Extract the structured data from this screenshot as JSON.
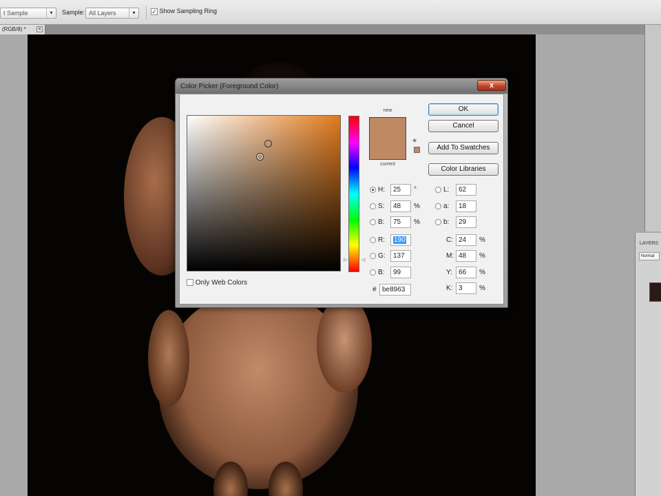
{
  "options_bar": {
    "sample_size": "t Sample",
    "sample_label": "Sample:",
    "sample_value": "All Layers",
    "show_ring_label": "Show Sampling Ring",
    "show_ring_checked": true
  },
  "document_tab": {
    "label": "(RGB/8) *",
    "close": "×"
  },
  "dialog": {
    "title": "Color Picker (Foreground Color)",
    "close": "x",
    "new_label": "new",
    "current_label": "current",
    "buttons": {
      "ok": "OK",
      "cancel": "Cancel",
      "add_to_swatches": "Add To Swatches",
      "color_libraries": "Color Libraries"
    },
    "hsb": [
      {
        "label": "H:",
        "value": "25",
        "unit": "°",
        "selected": true
      },
      {
        "label": "S:",
        "value": "48",
        "unit": "%",
        "selected": false
      },
      {
        "label": "B:",
        "value": "75",
        "unit": "%",
        "selected": false
      }
    ],
    "rgb": [
      {
        "label": "R:",
        "value": "190",
        "selected": false
      },
      {
        "label": "G:",
        "value": "137",
        "selected": false
      },
      {
        "label": "B:",
        "value": "99",
        "selected": false
      }
    ],
    "lab": [
      {
        "label": "L:",
        "value": "62"
      },
      {
        "label": "a:",
        "value": "18"
      },
      {
        "label": "b:",
        "value": "29"
      }
    ],
    "cmyk": [
      {
        "label": "C:",
        "value": "24",
        "unit": "%"
      },
      {
        "label": "M:",
        "value": "48",
        "unit": "%"
      },
      {
        "label": "Y:",
        "value": "66",
        "unit": "%"
      },
      {
        "label": "K:",
        "value": "3",
        "unit": "%"
      }
    ],
    "hex_label": "#",
    "hex": "be8963",
    "only_web_colors": "Only Web Colors",
    "colors": {
      "new": "#be8963",
      "current": "#be8963"
    }
  },
  "right_panel": {
    "layers_label": "LAYERS",
    "blend_mode": "Normal"
  }
}
